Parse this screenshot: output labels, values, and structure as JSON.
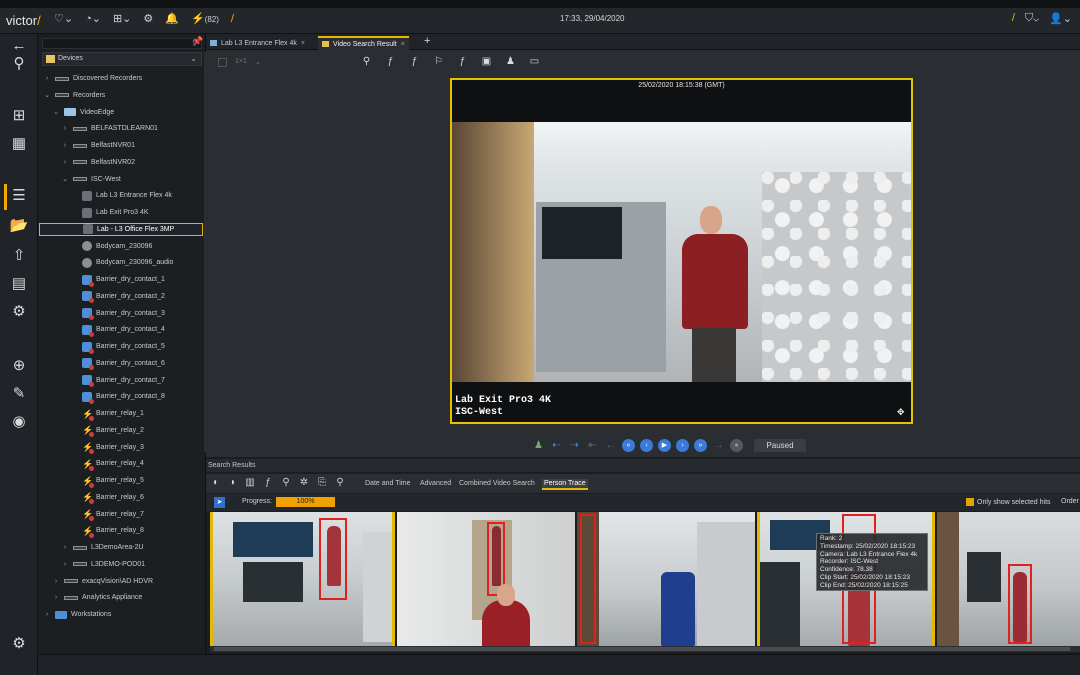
{
  "app": {
    "logo": "victor",
    "alerts_count": "(82)",
    "clock": "17:33, 29/04/2020"
  },
  "tree": {
    "root_label": "Devices",
    "items": [
      {
        "label": "Discovered Recorders",
        "arrow": "›",
        "icon": "recorder"
      },
      {
        "label": "Recorders",
        "arrow": "⌄",
        "icon": "recorder"
      },
      {
        "label": "VideoEdge",
        "arrow": "⌄",
        "icon": "folder"
      },
      {
        "label": "BELFASTDLEARN01",
        "arrow": "›",
        "icon": "recorder"
      },
      {
        "label": "BelfastNVR01",
        "arrow": "›",
        "icon": "recorder"
      },
      {
        "label": "BelfastNVR02",
        "arrow": "›",
        "icon": "recorder"
      },
      {
        "label": "ISC-West",
        "arrow": "⌄",
        "icon": "recorder"
      },
      {
        "label": "Lab L3 Entrance Flex 4k",
        "arrow": "",
        "icon": "camera"
      },
      {
        "label": "Lab Exit Pro3 4K",
        "arrow": "",
        "icon": "camera"
      },
      {
        "label": "Lab - L3 Office Flex 3MP",
        "arrow": "",
        "icon": "camera"
      },
      {
        "label": "Bodycam_230096",
        "arrow": "",
        "icon": "bodycam"
      },
      {
        "label": "Bodycam_230096_audio",
        "arrow": "",
        "icon": "bodycam"
      },
      {
        "label": "Barrier_dry_contact_1",
        "arrow": "",
        "icon": "contact"
      },
      {
        "label": "Barrier_dry_contact_2",
        "arrow": "",
        "icon": "contact"
      },
      {
        "label": "Barrier_dry_contact_3",
        "arrow": "",
        "icon": "contact"
      },
      {
        "label": "Barrier_dry_contact_4",
        "arrow": "",
        "icon": "contact"
      },
      {
        "label": "Barrier_dry_contact_5",
        "arrow": "",
        "icon": "contact"
      },
      {
        "label": "Barrier_dry_contact_6",
        "arrow": "",
        "icon": "contact"
      },
      {
        "label": "Barrier_dry_contact_7",
        "arrow": "",
        "icon": "contact"
      },
      {
        "label": "Barrier_dry_contact_8",
        "arrow": "",
        "icon": "contact"
      },
      {
        "label": "Barrier_relay_1",
        "arrow": "",
        "icon": "relay"
      },
      {
        "label": "Barrier_relay_2",
        "arrow": "",
        "icon": "relay"
      },
      {
        "label": "Barrier_relay_3",
        "arrow": "",
        "icon": "relay"
      },
      {
        "label": "Barrier_relay_4",
        "arrow": "",
        "icon": "relay"
      },
      {
        "label": "Barrier_relay_5",
        "arrow": "",
        "icon": "relay"
      },
      {
        "label": "Barrier_relay_6",
        "arrow": "",
        "icon": "relay"
      },
      {
        "label": "Barrier_relay_7",
        "arrow": "",
        "icon": "relay"
      },
      {
        "label": "Barrier_relay_8",
        "arrow": "",
        "icon": "relay"
      },
      {
        "label": "L3DemoArea-2U",
        "arrow": "›",
        "icon": "recorder"
      },
      {
        "label": "L3DEMO-POD01",
        "arrow": "›",
        "icon": "recorder"
      },
      {
        "label": "exacqVision\\AD HDVR",
        "arrow": "›",
        "icon": "recorder"
      },
      {
        "label": "Analytics Appliance",
        "arrow": "›",
        "icon": "recorder"
      },
      {
        "label": "Workstations",
        "arrow": "›",
        "icon": "workstation"
      }
    ]
  },
  "tabs": [
    {
      "label": "Lab L3 Entrance Flex 4k",
      "close": "×"
    },
    {
      "label": "Video Search Result",
      "close": "×"
    }
  ],
  "tab_add": "+",
  "viewer": {
    "layout_label": "1×1",
    "timestamp": "25/02/2020 18:15:38 (GMT)",
    "caption_line1": "Lab Exit Pro3 4K",
    "caption_line2": "ISC-West",
    "status": "Paused"
  },
  "results": {
    "header": "Search Results",
    "tabs": [
      "Date and Time",
      "Advanced",
      "Combined Video Search",
      "Person Trace"
    ],
    "active_tab": "Person Trace",
    "progress_label": "Progress:",
    "progress_text": "100%",
    "progress_value": 100,
    "only_selected_label": "Only show selected hits",
    "order_label": "Order"
  },
  "tooltip": {
    "lines": [
      "Rank: 2",
      "Timestamp: 25/02/2020 18:15:23",
      "Camera: Lab L3 Entrance Flex 4k",
      "Recorder: ISC-West",
      "Confidence: 78.38",
      "Clip Start: 25/02/2020 18:15:23",
      "Clip End: 25/02/2020 18:15:25"
    ]
  },
  "colors": {
    "accent": "#e5b900",
    "detection_box": "#e0221f",
    "play_blue": "#3a7ad8"
  }
}
